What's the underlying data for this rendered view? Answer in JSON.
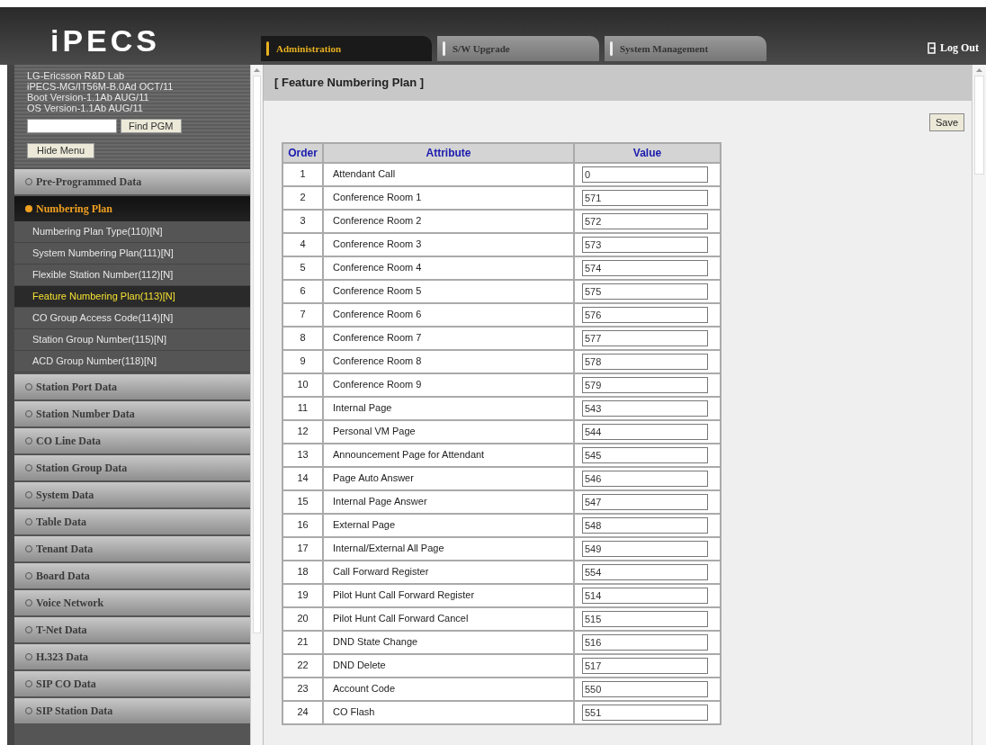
{
  "logo": {
    "text": "iPECS"
  },
  "tabs": [
    {
      "label": "Administration",
      "selected": true
    },
    {
      "label": "S/W Upgrade",
      "selected": false
    },
    {
      "label": "System Management",
      "selected": false
    }
  ],
  "logout": {
    "label": "Log Out"
  },
  "system_info": [
    "LG-Ericsson R&D Lab",
    "iPECS-MG/IT56M-B.0Ad OCT/11",
    "Boot Version-1.1Ab AUG/11",
    "OS Version-1.1Ab AUG/11"
  ],
  "find_button": "Find PGM",
  "hide_menu_button": "Hide Menu",
  "menu": [
    {
      "label": "Pre-Programmed Data",
      "expanded": false
    },
    {
      "label": "Numbering Plan",
      "expanded": true,
      "children": [
        {
          "label": "Numbering Plan Type(110)[N]",
          "selected": false
        },
        {
          "label": "System Numbering Plan(111)[N]",
          "selected": false
        },
        {
          "label": "Flexible Station Number(112)[N]",
          "selected": false
        },
        {
          "label": "Feature Numbering Plan(113)[N]",
          "selected": true
        },
        {
          "label": "CO Group Access Code(114)[N]",
          "selected": false
        },
        {
          "label": "Station Group Number(115)[N]",
          "selected": false
        },
        {
          "label": "ACD Group Number(118)[N]",
          "selected": false
        }
      ]
    },
    {
      "label": "Station Port Data",
      "expanded": false
    },
    {
      "label": "Station Number Data",
      "expanded": false
    },
    {
      "label": "CO Line Data",
      "expanded": false
    },
    {
      "label": "Station Group Data",
      "expanded": false
    },
    {
      "label": "System Data",
      "expanded": false
    },
    {
      "label": "Table Data",
      "expanded": false
    },
    {
      "label": "Tenant Data",
      "expanded": false
    },
    {
      "label": "Board Data",
      "expanded": false
    },
    {
      "label": "Voice Network",
      "expanded": false
    },
    {
      "label": "T-Net Data",
      "expanded": false
    },
    {
      "label": "H.323 Data",
      "expanded": false
    },
    {
      "label": "SIP CO Data",
      "expanded": false
    },
    {
      "label": "SIP Station Data",
      "expanded": false
    }
  ],
  "page_title": "[ Feature Numbering Plan ]",
  "save_button": "Save",
  "table": {
    "columns": [
      "Order",
      "Attribute",
      "Value"
    ],
    "rows": [
      [
        "1",
        "Attendant Call",
        "0"
      ],
      [
        "2",
        "Conference Room 1",
        "571"
      ],
      [
        "3",
        "Conference Room 2",
        "572"
      ],
      [
        "4",
        "Conference Room 3",
        "573"
      ],
      [
        "5",
        "Conference Room 4",
        "574"
      ],
      [
        "6",
        "Conference Room 5",
        "575"
      ],
      [
        "7",
        "Conference Room 6",
        "576"
      ],
      [
        "8",
        "Conference Room 7",
        "577"
      ],
      [
        "9",
        "Conference Room 8",
        "578"
      ],
      [
        "10",
        "Conference Room 9",
        "579"
      ],
      [
        "11",
        "Internal Page",
        "543"
      ],
      [
        "12",
        "Personal VM Page",
        "544"
      ],
      [
        "13",
        "Announcement Page for Attendant",
        "545"
      ],
      [
        "14",
        "Page Auto Answer",
        "546"
      ],
      [
        "15",
        "Internal Page Answer",
        "547"
      ],
      [
        "16",
        "External Page",
        "548"
      ],
      [
        "17",
        "Internal/External All Page",
        "549"
      ],
      [
        "18",
        "Call Forward Register",
        "554"
      ],
      [
        "19",
        "Pilot Hunt Call Forward Register",
        "514"
      ],
      [
        "20",
        "Pilot Hunt Call Forward Cancel",
        "515"
      ],
      [
        "21",
        "DND State Change",
        "516"
      ],
      [
        "22",
        "DND Delete",
        "517"
      ],
      [
        "23",
        "Account Code",
        "550"
      ],
      [
        "24",
        "CO Flash",
        "551"
      ]
    ]
  }
}
